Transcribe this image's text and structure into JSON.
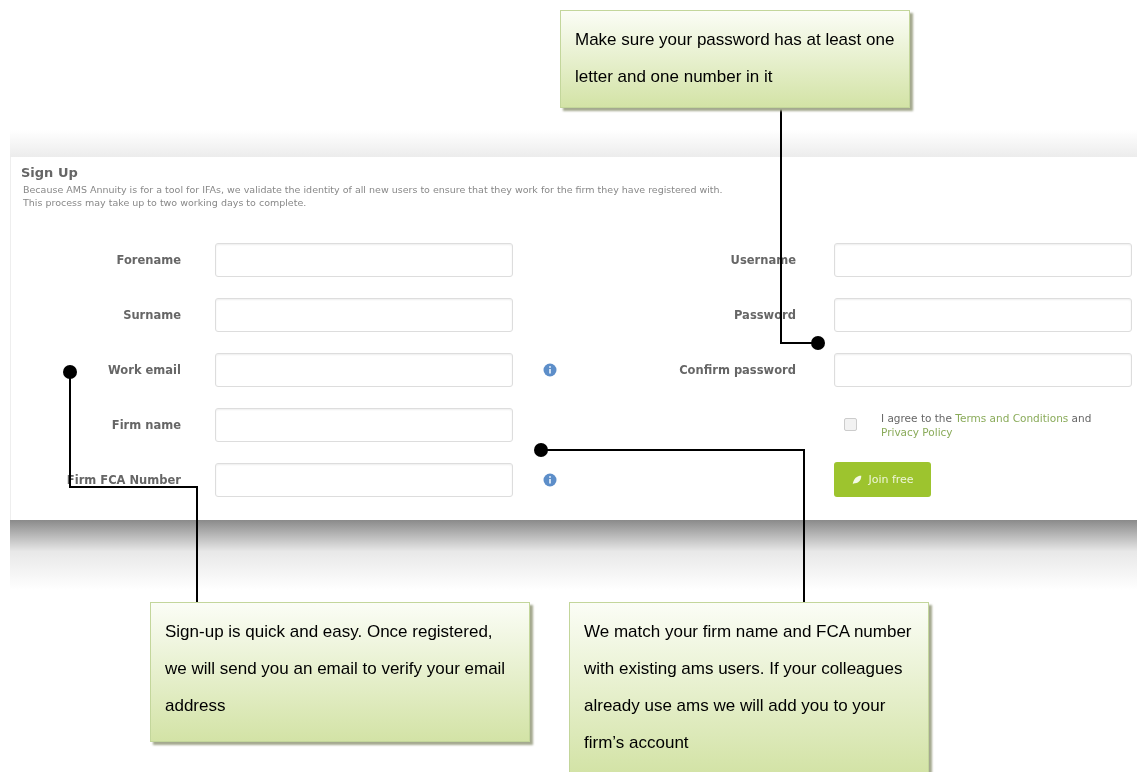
{
  "form": {
    "title": "Sign Up",
    "description_lines": [
      "Because AMS Annuity is for a tool for IFAs, we validate the identity of all new users to ensure that they work for the firm they have registered with.",
      "This process may take up to two working days to complete."
    ],
    "left_fields": [
      {
        "label": "Forename",
        "info": false
      },
      {
        "label": "Surname",
        "info": false
      },
      {
        "label": "Work email",
        "info": true
      },
      {
        "label": "Firm name",
        "info": false
      },
      {
        "label": "Firm FCA Number",
        "info": true
      }
    ],
    "right_items": [
      {
        "kind": "field",
        "label": "Username"
      },
      {
        "kind": "field",
        "label": "Password"
      },
      {
        "kind": "field",
        "label": "Confirm password"
      },
      {
        "kind": "agreement",
        "checked": false,
        "text_before": "I agree to the",
        "terms_link": "Terms and Conditions",
        "middle": "and",
        "privacy_link": "Privacy Policy"
      },
      {
        "kind": "button",
        "label": "Join free"
      }
    ]
  },
  "callouts": [
    {
      "text": "Make sure your password has at least one letter and one number in it"
    },
    {
      "text": "Sign-up is quick and easy. Once registered, we will send you an email to verify your email address"
    },
    {
      "text": "We match your firm name and FCA number with existing ams users. If your colleagues already use ams we will add you to your firm’s account"
    }
  ]
}
